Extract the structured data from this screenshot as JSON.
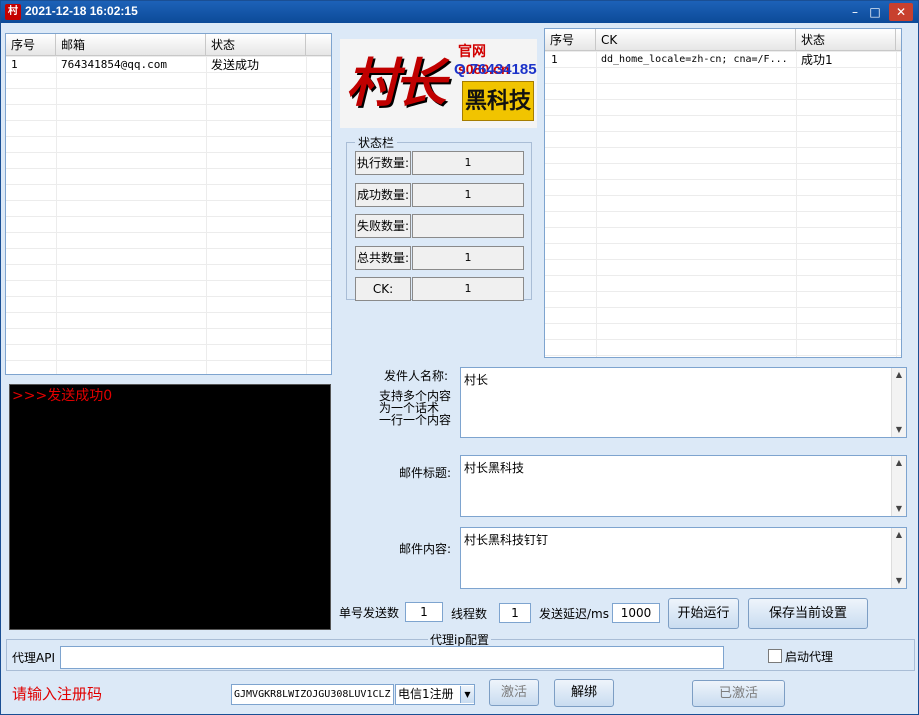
{
  "window": {
    "app_icon_text": "村",
    "title": "2021-12-18 16:02:15",
    "min_glyph": "–",
    "max_glyph": "□",
    "close_glyph": "✕"
  },
  "email_list": {
    "columns": [
      "序号",
      "邮箱",
      "状态"
    ],
    "rows": [
      {
        "index": "1",
        "email": "764341854@qq.com",
        "status": "发送成功"
      }
    ]
  },
  "logo": {
    "mark": "村长",
    "site": "官网 s080.cn",
    "qq": "Q.764341854",
    "tag": "黑科技"
  },
  "status_panel": {
    "title": "状态栏",
    "rows": [
      {
        "label": "执行数量:",
        "value": "1"
      },
      {
        "label": "成功数量:",
        "value": "1"
      },
      {
        "label": "失败数量:",
        "value": ""
      },
      {
        "label": "总共数量:",
        "value": "1"
      },
      {
        "label": "CK:",
        "value": "1"
      }
    ]
  },
  "ck_list": {
    "columns": [
      "序号",
      "CK",
      "状态"
    ],
    "rows": [
      {
        "index": "1",
        "ck": "dd_home_locale=zh-cn; cna=/F...",
        "status": "成功1"
      }
    ]
  },
  "console": {
    "text": ">>>发送成功0"
  },
  "form": {
    "sender_label": "发件人名称:",
    "sender_hint": "支持多个内容\n为一个话术\n一行一个内容",
    "sender_value": "村长",
    "subject_label": "邮件标题:",
    "subject_value": "村长黑科技",
    "content_label": "邮件内容:",
    "content_value": "村长黑科技钉钉",
    "per_account_label": "单号发送数",
    "per_account_value": "1",
    "threads_label": "线程数",
    "threads_value": "1",
    "delay_label": "发送延迟/ms",
    "delay_value": "1000",
    "start_button": "开始运行",
    "save_button": "保存当前设置"
  },
  "proxy": {
    "group_title": "代理ip配置",
    "api_label": "代理API",
    "api_value": "",
    "enable_label": "启动代理",
    "enabled": false
  },
  "registration": {
    "prompt": "请输入注册码",
    "code": "GJMVGKR8LWIZOJGU308LUV1CLZ",
    "type_selected": "电信1注册",
    "activate_button": "激活",
    "unbind_button": "解绑",
    "activated_button": "已激活"
  },
  "colors": {
    "window_bg": "#dce9f7",
    "titlebar": "#0c4a98",
    "console_text": "#e00000",
    "console_bg": "#000000",
    "prompt_text": "#e00000"
  }
}
